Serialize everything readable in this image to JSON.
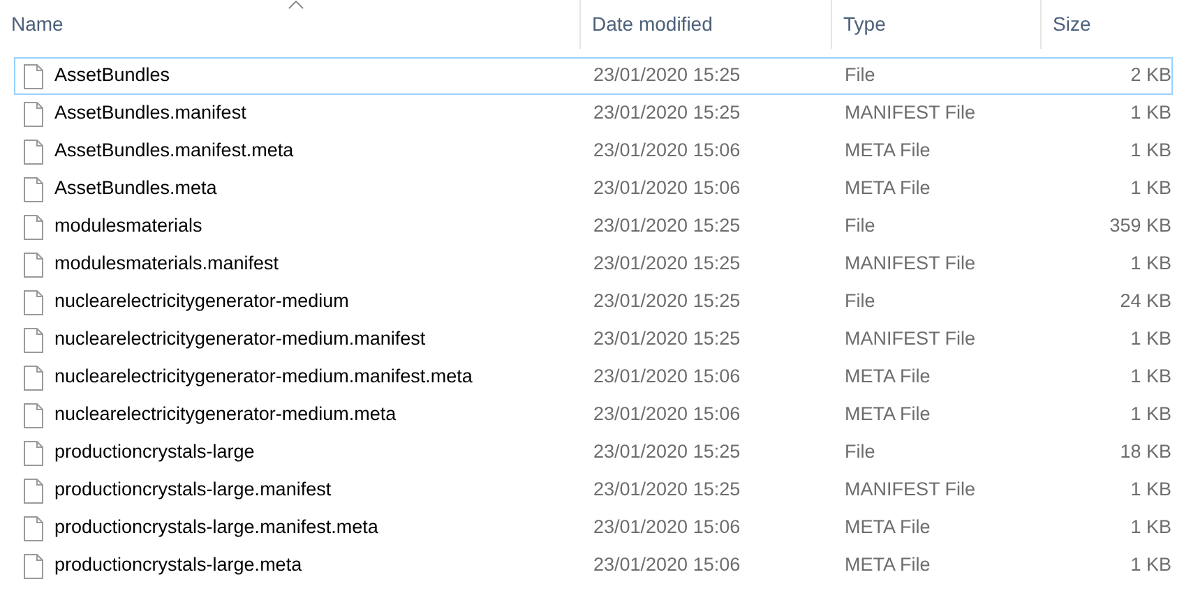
{
  "columns": [
    {
      "label": "Name",
      "sorted": true
    },
    {
      "label": "Date modified",
      "sorted": false
    },
    {
      "label": "Type",
      "sorted": false
    },
    {
      "label": "Size",
      "sorted": false
    }
  ],
  "files": [
    {
      "name": "AssetBundles",
      "date": "23/01/2020 15:25",
      "type": "File",
      "size": "2 KB",
      "focused": true
    },
    {
      "name": "AssetBundles.manifest",
      "date": "23/01/2020 15:25",
      "type": "MANIFEST File",
      "size": "1 KB",
      "focused": false
    },
    {
      "name": "AssetBundles.manifest.meta",
      "date": "23/01/2020 15:06",
      "type": "META File",
      "size": "1 KB",
      "focused": false
    },
    {
      "name": "AssetBundles.meta",
      "date": "23/01/2020 15:06",
      "type": "META File",
      "size": "1 KB",
      "focused": false
    },
    {
      "name": "modulesmaterials",
      "date": "23/01/2020 15:25",
      "type": "File",
      "size": "359 KB",
      "focused": false
    },
    {
      "name": "modulesmaterials.manifest",
      "date": "23/01/2020 15:25",
      "type": "MANIFEST File",
      "size": "1 KB",
      "focused": false
    },
    {
      "name": "nuclearelectricitygenerator-medium",
      "date": "23/01/2020 15:25",
      "type": "File",
      "size": "24 KB",
      "focused": false
    },
    {
      "name": "nuclearelectricitygenerator-medium.manifest",
      "date": "23/01/2020 15:25",
      "type": "MANIFEST File",
      "size": "1 KB",
      "focused": false
    },
    {
      "name": "nuclearelectricitygenerator-medium.manifest.meta",
      "date": "23/01/2020 15:06",
      "type": "META File",
      "size": "1 KB",
      "focused": false
    },
    {
      "name": "nuclearelectricitygenerator-medium.meta",
      "date": "23/01/2020 15:06",
      "type": "META File",
      "size": "1 KB",
      "focused": false
    },
    {
      "name": "productioncrystals-large",
      "date": "23/01/2020 15:25",
      "type": "File",
      "size": "18 KB",
      "focused": false
    },
    {
      "name": "productioncrystals-large.manifest",
      "date": "23/01/2020 15:25",
      "type": "MANIFEST File",
      "size": "1 KB",
      "focused": false
    },
    {
      "name": "productioncrystals-large.manifest.meta",
      "date": "23/01/2020 15:06",
      "type": "META File",
      "size": "1 KB",
      "focused": false
    },
    {
      "name": "productioncrystals-large.meta",
      "date": "23/01/2020 15:06",
      "type": "META File",
      "size": "1 KB",
      "focused": false
    }
  ]
}
